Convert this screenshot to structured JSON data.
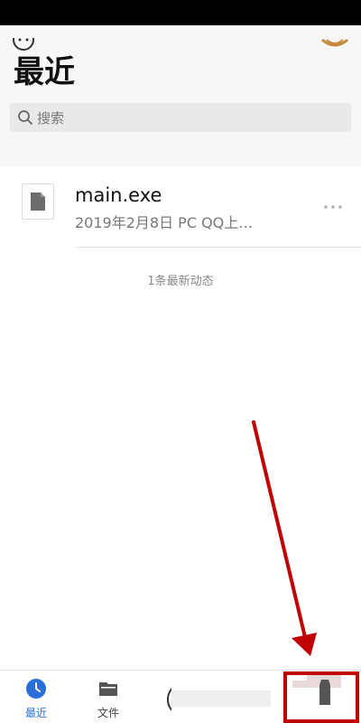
{
  "header": {
    "title": "最近"
  },
  "search": {
    "placeholder": "搜索"
  },
  "files": [
    {
      "name": "main.exe",
      "meta": "2019年2月8日  PC QQ上…",
      "icon": "document-icon"
    }
  ],
  "activity": {
    "summary": "1条最新动态"
  },
  "bottom_nav": {
    "tabs": [
      {
        "label": "最近",
        "icon": "clock-icon",
        "active": true
      },
      {
        "label": "文件",
        "icon": "folder-icon",
        "active": false
      }
    ]
  },
  "annotation": {
    "arrow_color": "#c00000",
    "box_color": "#c00000"
  },
  "colors": {
    "accent": "#2a6fd8",
    "status_bar": "#000000"
  }
}
